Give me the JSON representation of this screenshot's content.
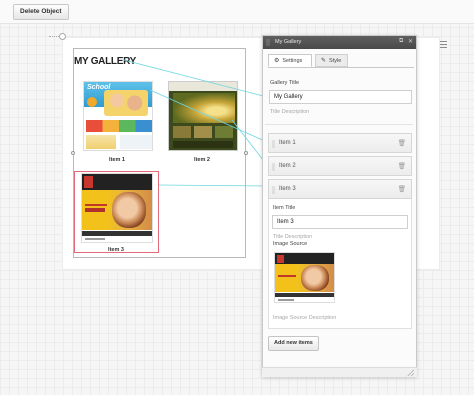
{
  "toolbar": {
    "delete_label": "Delete Object"
  },
  "gallery": {
    "title": "MY GALLERY",
    "items": [
      {
        "caption": "Item 1",
        "thumb_title": "School"
      },
      {
        "caption": "Item 2"
      },
      {
        "caption": "Item 3"
      }
    ]
  },
  "panel": {
    "title": "My Gallery",
    "tabs": {
      "settings": "Settings",
      "style": "Style"
    },
    "gallery_title_label": "Gallery Title",
    "gallery_title_value": "My Gallery",
    "title_description": "Title Description",
    "items": [
      {
        "label": "Item 1"
      },
      {
        "label": "Item 2"
      },
      {
        "label": "Item 3"
      }
    ],
    "item_title_label": "Item Title",
    "item_title_value": "Item 3",
    "item_title_description": "Title Description",
    "image_source_label": "Image Source",
    "image_source_description": "Image Source Description",
    "add_item_label": "Add new items"
  },
  "colors": {
    "selection": "#e46b7c",
    "connector": "#6cd6e0",
    "panel_header": "#4f4f4f"
  },
  "icons": [
    "gear-icon",
    "brush-icon",
    "trash-icon",
    "menu-icon",
    "close-icon",
    "pin-icon"
  ]
}
